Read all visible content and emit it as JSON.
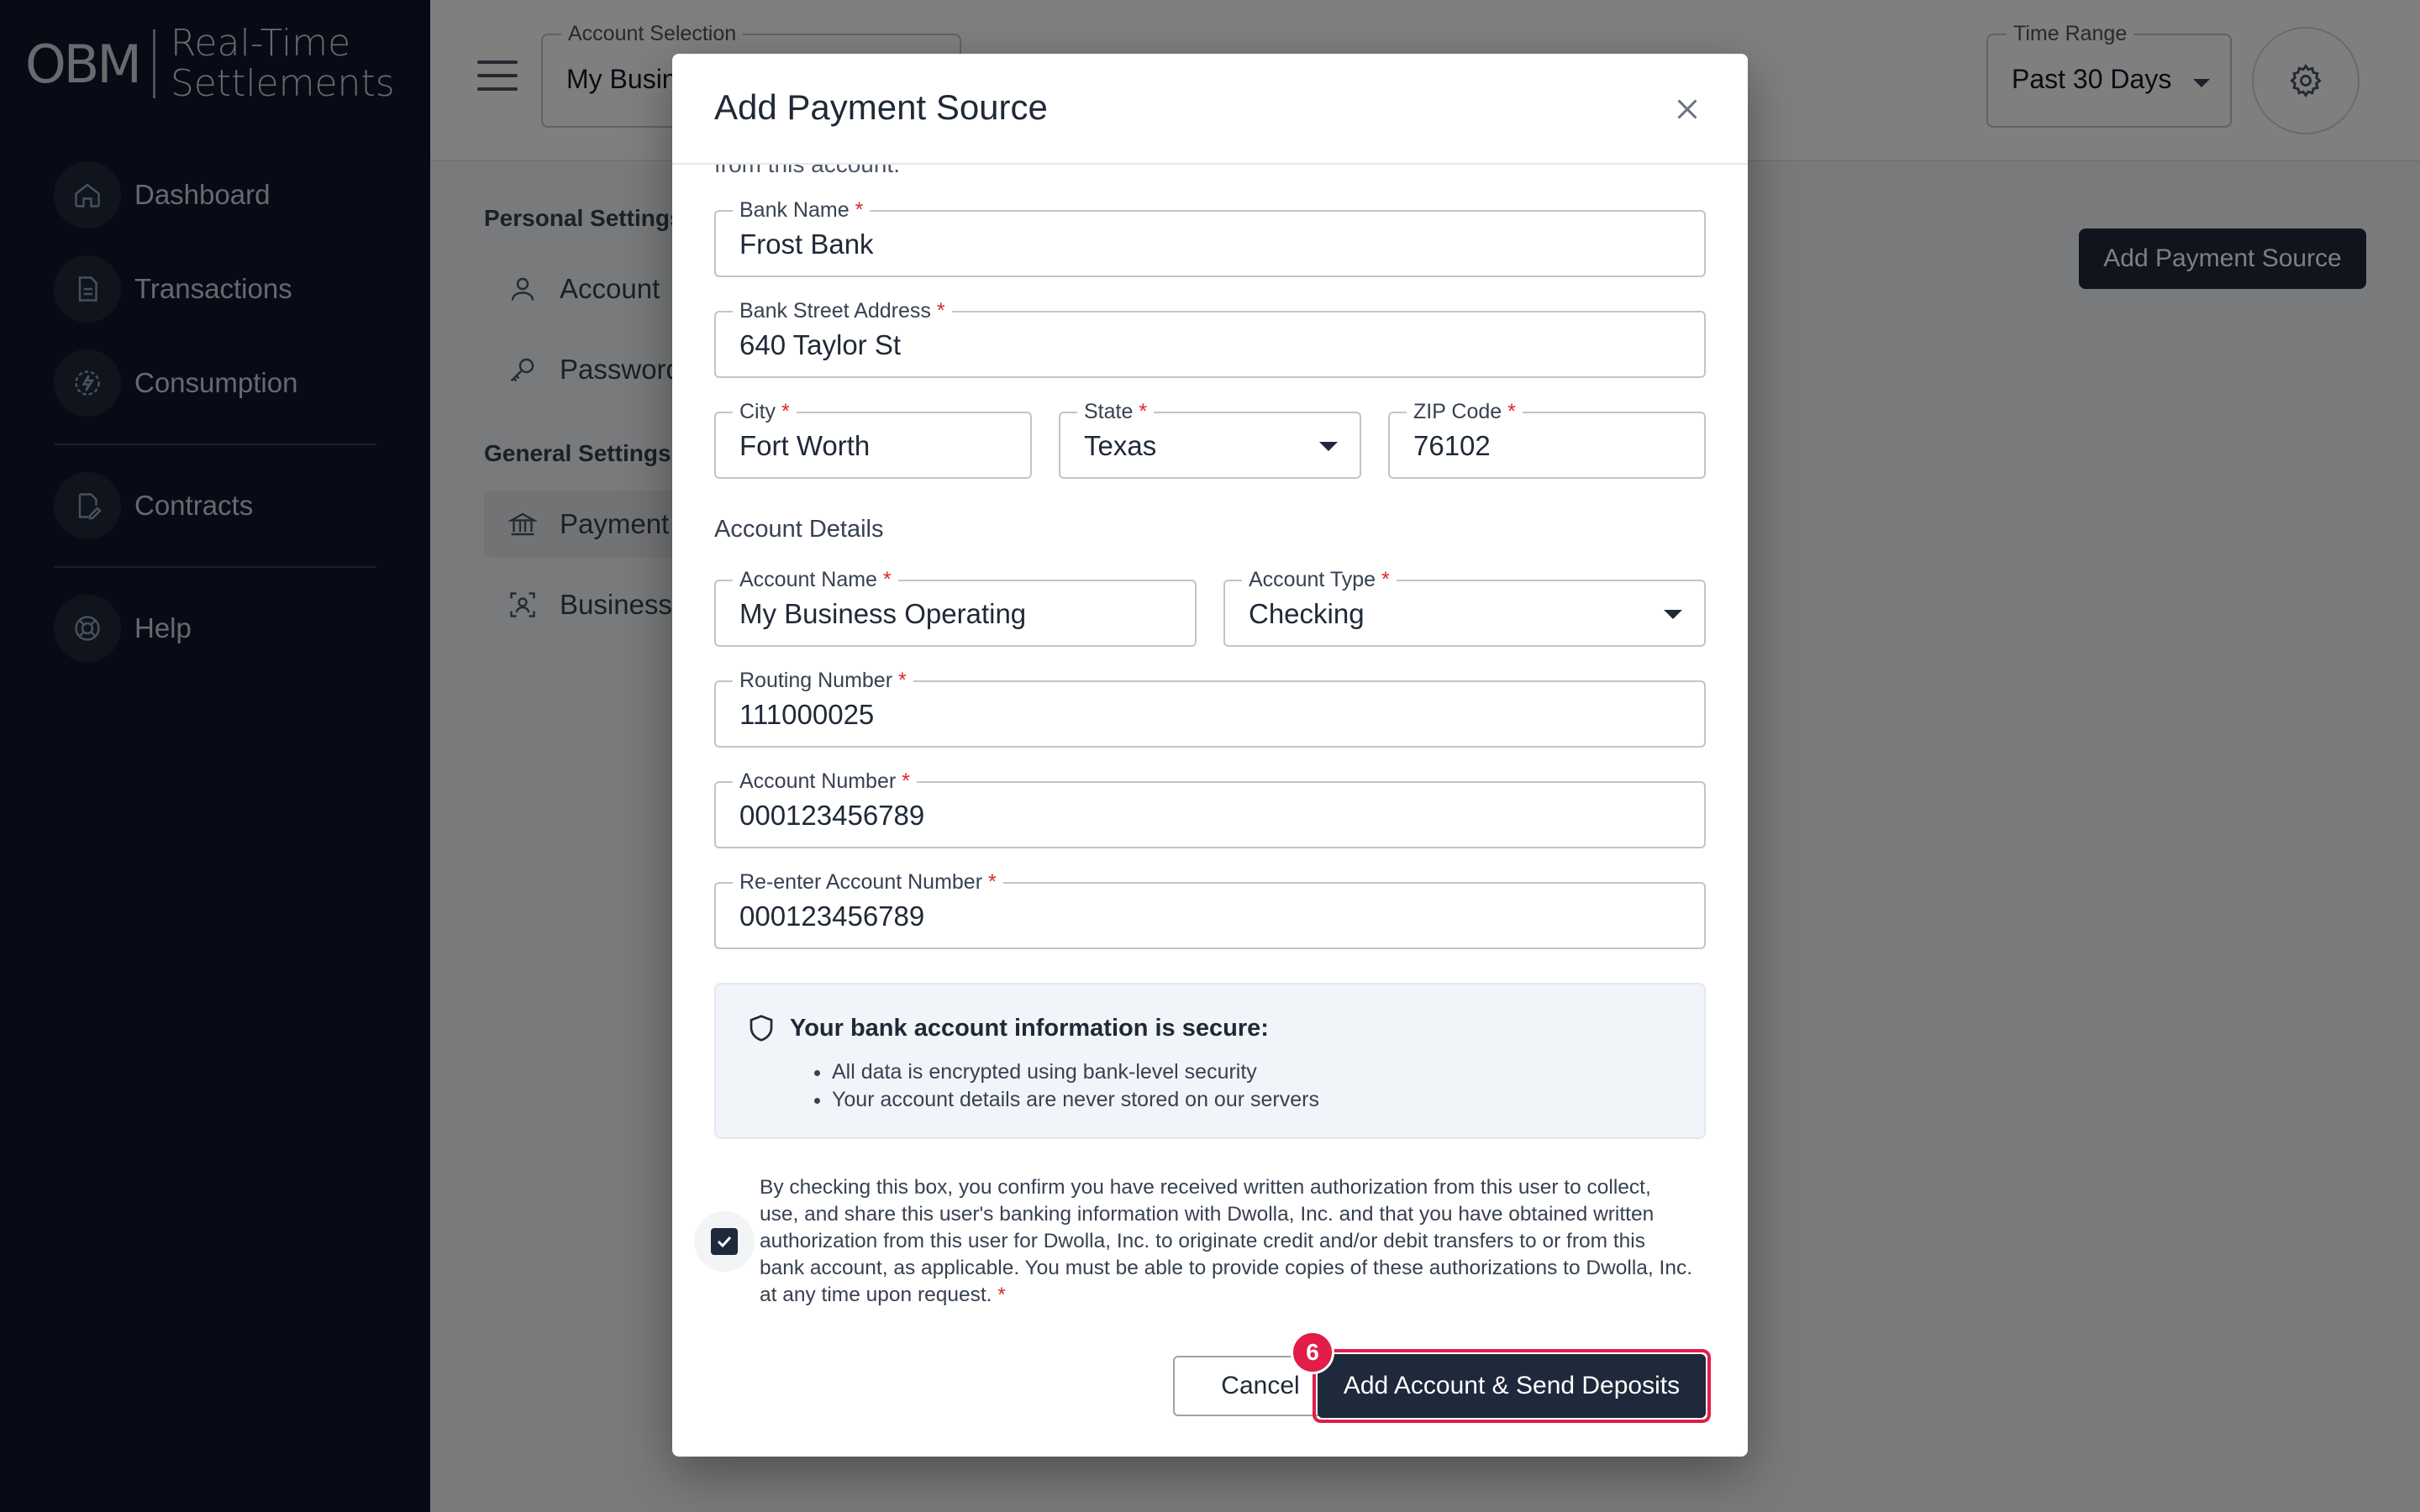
{
  "sidebar": {
    "logo_mark": "OBM",
    "logo_line1": "Real-Time",
    "logo_line2": "Settlements",
    "items": [
      {
        "label": "Dashboard",
        "icon": "home-icon"
      },
      {
        "label": "Transactions",
        "icon": "document-icon"
      },
      {
        "label": "Consumption",
        "icon": "lightning-icon"
      },
      {
        "label": "Contracts",
        "icon": "contract-edit-icon"
      },
      {
        "label": "Help",
        "icon": "lifebuoy-icon"
      }
    ]
  },
  "header": {
    "account_selection_label": "Account Selection",
    "account_selection_value": "My Business Operating",
    "time_range_label": "Time Range",
    "time_range_value": "Past 30 Days"
  },
  "settings": {
    "personal_heading": "Personal Settings",
    "account_item": "Account",
    "password_item": "Password",
    "general_heading": "General Settings",
    "payment_item": "Payment Sources",
    "business_item": "Business",
    "add_payment_button": "Add Payment Source"
  },
  "modal": {
    "title": "Add Payment Source",
    "cut_text": "from this account.",
    "bank_name": {
      "label": "Bank Name",
      "value": "Frost Bank"
    },
    "bank_street": {
      "label": "Bank Street Address",
      "value": "640 Taylor St"
    },
    "city": {
      "label": "City",
      "value": "Fort Worth"
    },
    "state": {
      "label": "State",
      "value": "Texas"
    },
    "zip": {
      "label": "ZIP Code",
      "value": "76102"
    },
    "account_details_title": "Account Details",
    "account_name": {
      "label": "Account Name",
      "value": "My Business Operating"
    },
    "account_type": {
      "label": "Account Type",
      "value": "Checking"
    },
    "routing_number": {
      "label": "Routing Number",
      "value": "111000025"
    },
    "account_number": {
      "label": "Account Number",
      "value": "000123456789"
    },
    "reenter_account_number": {
      "label": "Re-enter Account Number",
      "value": "000123456789"
    },
    "required_mark": "*",
    "secure": {
      "title": "Your bank account information is secure:",
      "items": [
        "All data is encrypted using bank-level security",
        "Your account details are never stored on our servers"
      ]
    },
    "consent_text": "By checking this box, you confirm you have received written authorization from this user to collect, use, and share this user's banking information with Dwolla, Inc. and that you have obtained written authorization from this user for Dwolla, Inc. to originate credit and/or debit transfers to or from this bank account, as applicable. You must be able to provide copies of these authorizations to Dwolla, Inc. at any time upon request.",
    "consent_checked": true,
    "cancel_label": "Cancel",
    "submit_label": "Add Account & Send Deposits",
    "step_badge": "6"
  },
  "colors": {
    "sidebar_bg": "#0f172a",
    "primary": "#1e293b",
    "highlight": "#e11d48"
  }
}
